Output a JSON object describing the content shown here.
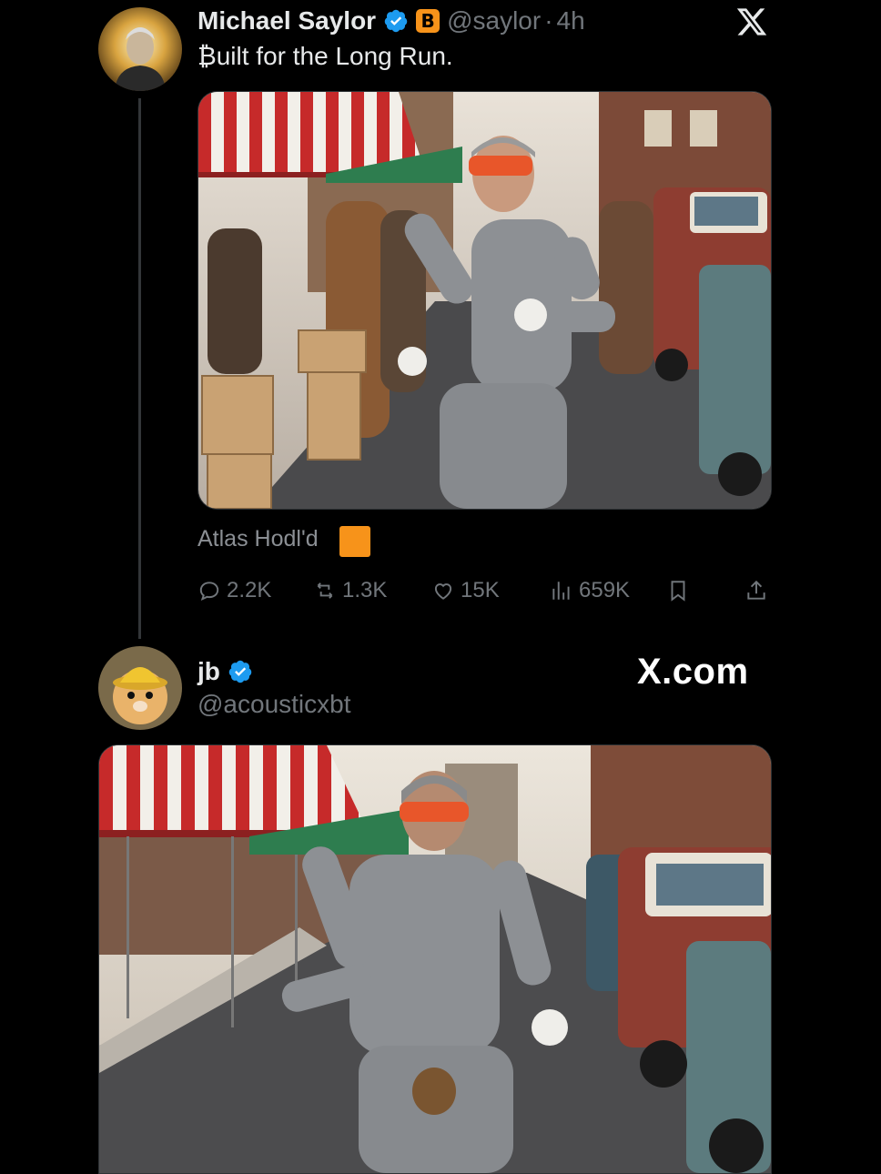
{
  "tweet1": {
    "display_name": "Michael Saylor",
    "handle": "@saylor",
    "separator": "·",
    "time": "4h",
    "text": "₿uilt for the Long Run.",
    "reply_text": "Atlas Hodl'd",
    "stats": {
      "replies": "2.2K",
      "reposts": "1.3K",
      "likes": "15K",
      "views": "659K"
    }
  },
  "tweet2": {
    "display_name": "jb",
    "handle": "@acousticxbt"
  },
  "watermark": "X.com",
  "btc_symbol": "B",
  "colors": {
    "background": "#000000",
    "text": "#e7e9ea",
    "secondary": "#71767b",
    "verified": "#1d9bf0",
    "bitcoin": "#f7931a",
    "headband": "#e8562a"
  },
  "icons": [
    "x-logo-icon",
    "verified-icon",
    "bitcoin-icon",
    "reply-icon",
    "repost-icon",
    "like-icon",
    "views-icon",
    "bookmark-icon",
    "share-icon"
  ]
}
